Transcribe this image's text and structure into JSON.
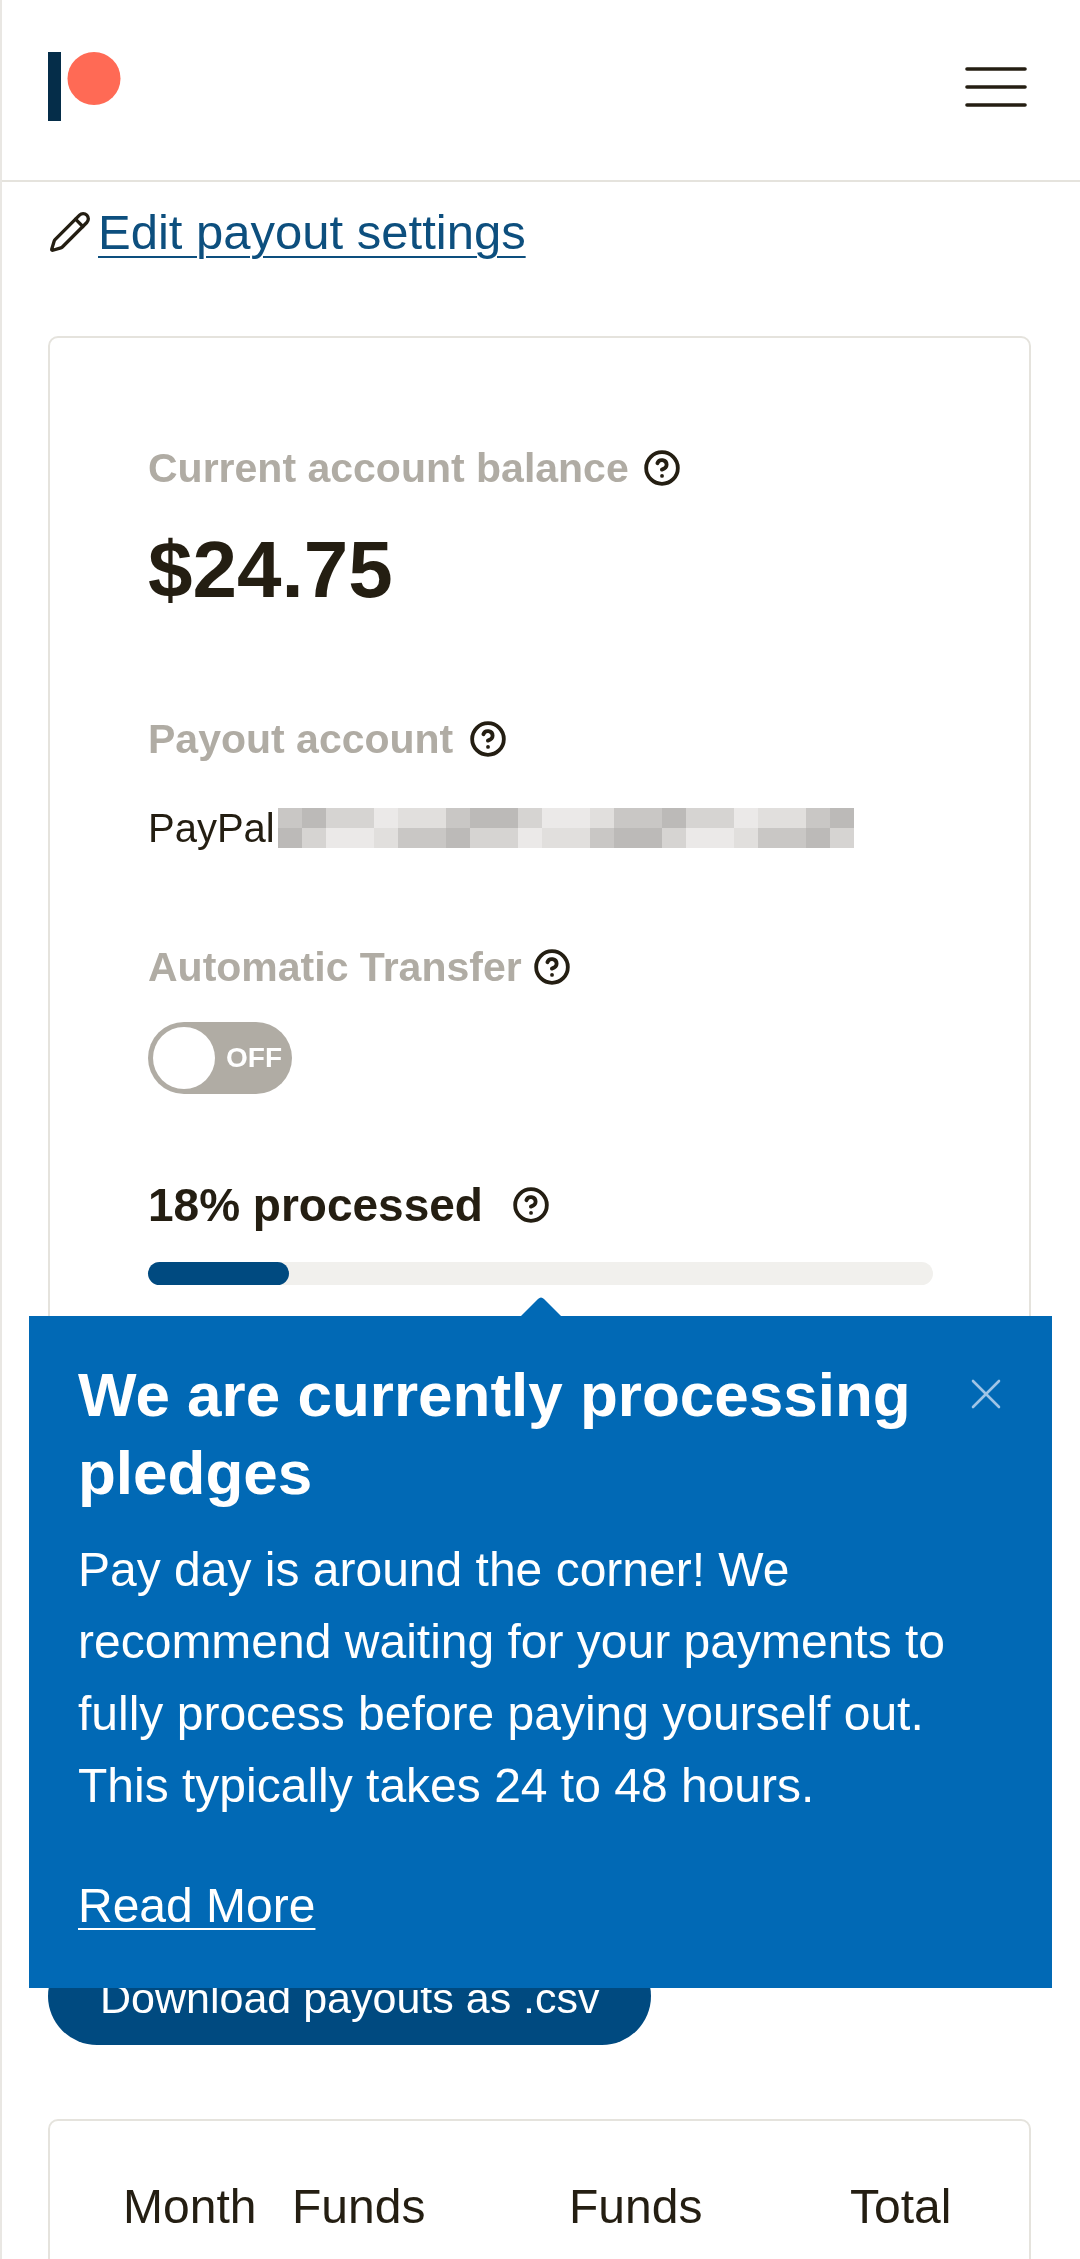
{
  "edit_link": {
    "label": "Edit payout settings"
  },
  "balance_card": {
    "balance": {
      "label": "Current account balance",
      "amount": "$24.75"
    },
    "payout_account": {
      "label": "Payout account",
      "value": "PayPal"
    },
    "automatic_transfer": {
      "label": "Automatic Transfer",
      "on": false,
      "state_text": "OFF"
    },
    "progress": {
      "label": "18% processed",
      "level": 0.18
    }
  },
  "popup": {
    "title": "We are currently processing pledges",
    "message": "Pay day is around the corner! We recommend waiting for your payments to fully process before paying yourself out. This typically takes 24 to 48 hours.",
    "link": "Read More"
  },
  "download_button": {
    "label": "Download payouts as .csv"
  },
  "payouts_table": {
    "columns": [
      "Month",
      "Funds",
      "Funds",
      "Total"
    ]
  }
}
